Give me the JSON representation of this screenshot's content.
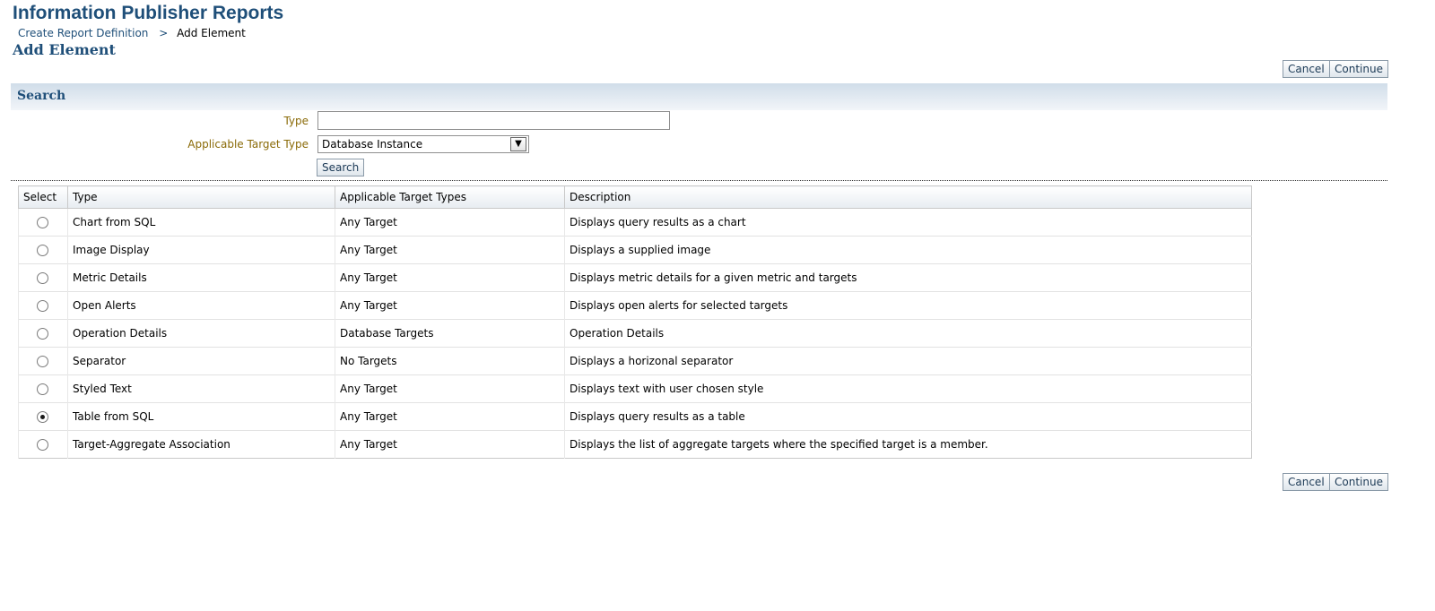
{
  "header": {
    "title": "Information Publisher Reports",
    "breadcrumb": {
      "link": "Create Report Definition",
      "separator": ">",
      "current": "Add Element"
    },
    "subtitle": "Add Element"
  },
  "actions": {
    "cancel_label": "Cancel",
    "continue_label": "Continue"
  },
  "search": {
    "heading": "Search",
    "type_label": "Type",
    "type_value": "",
    "target_type_label": "Applicable Target Type",
    "target_type_value": "Database Instance",
    "button_label": "Search"
  },
  "table": {
    "columns": [
      "Select",
      "Type",
      "Applicable Target Types",
      "Description"
    ],
    "rows": [
      {
        "selected": false,
        "type": "Chart from SQL",
        "targets": "Any Target",
        "description": "Displays query results as a chart"
      },
      {
        "selected": false,
        "type": "Image Display",
        "targets": "Any Target",
        "description": "Displays a supplied image"
      },
      {
        "selected": false,
        "type": "Metric Details",
        "targets": "Any Target",
        "description": "Displays metric details for a given metric and targets"
      },
      {
        "selected": false,
        "type": "Open Alerts",
        "targets": "Any Target",
        "description": "Displays open alerts for selected targets"
      },
      {
        "selected": false,
        "type": "Operation Details",
        "targets": "Database Targets",
        "description": "Operation Details"
      },
      {
        "selected": false,
        "type": "Separator",
        "targets": "No Targets",
        "description": "Displays a horizonal separator"
      },
      {
        "selected": false,
        "type": "Styled Text",
        "targets": "Any Target",
        "description": "Displays text with user chosen style"
      },
      {
        "selected": true,
        "type": "Table from SQL",
        "targets": "Any Target",
        "description": "Displays query results as a table"
      },
      {
        "selected": false,
        "type": "Target-Aggregate Association",
        "targets": "Any Target",
        "description": "Displays the list of aggregate targets where the specified target is a member."
      }
    ]
  }
}
